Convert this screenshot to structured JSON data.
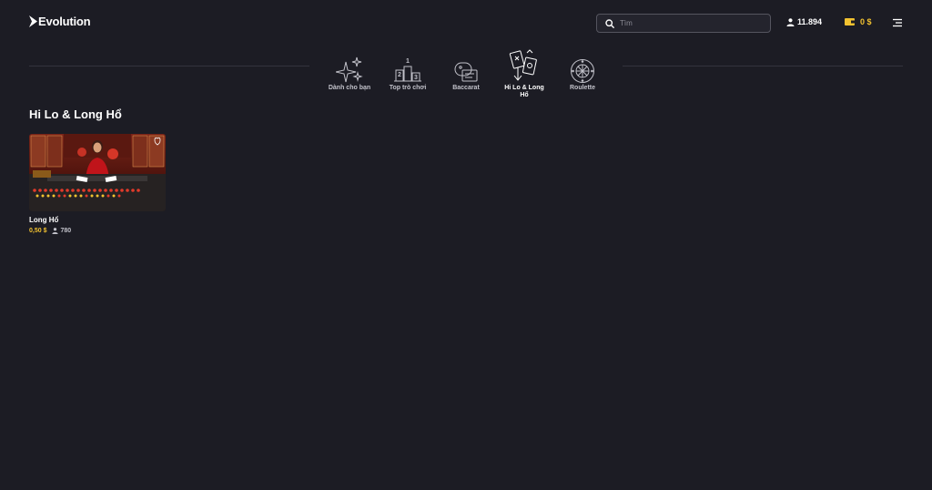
{
  "header": {
    "logo_text": "Evolution",
    "search_placeholder": "Tìm",
    "players_count": "11.894",
    "balance": "0 $"
  },
  "categories": [
    {
      "label": "Dành cho bạn",
      "icon": "sparkle-icon",
      "active": false
    },
    {
      "label": "Top trò chơi",
      "icon": "podium-icon",
      "active": false
    },
    {
      "label": "Baccarat",
      "icon": "baccarat-icon",
      "active": false
    },
    {
      "label": "Hi Lo & Long Hổ",
      "icon": "hilo-cards-icon",
      "active": true
    },
    {
      "label": "Roulette",
      "icon": "roulette-wheel-icon",
      "active": false
    }
  ],
  "section": {
    "title": "Hi Lo & Long Hổ"
  },
  "games": [
    {
      "name": "Long Hổ",
      "min_bet": "0,50 $",
      "players": "780"
    }
  ],
  "colors": {
    "background": "#1c1c24",
    "accent": "#f2c230",
    "muted_text": "#c2c2ca"
  }
}
